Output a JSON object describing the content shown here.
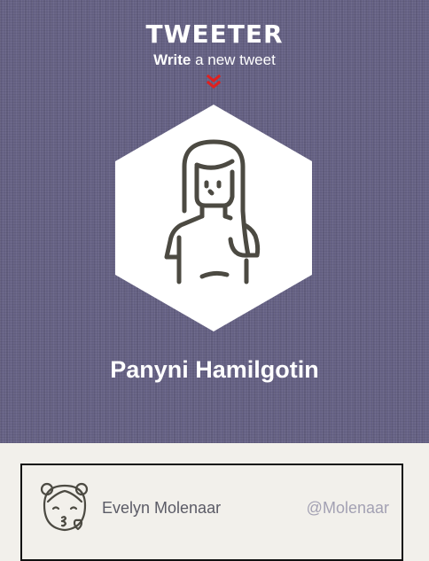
{
  "app": {
    "brand": "TWEETER",
    "tagline_strong": "Write",
    "tagline_rest": " a new tweet"
  },
  "hero": {
    "avatar_icon": "woman-avatar-icon",
    "scroll_icon": "double-chevron-down-icon",
    "user_name": "Panyni Hamilgotin"
  },
  "tweet": {
    "avatar_icon": "kiss-girl-avatar-icon",
    "display_name": "Evelyn Molenaar",
    "handle": "@Molenaar"
  },
  "colors": {
    "hero_bg": "#676386",
    "page_bg": "#f2f0eb",
    "accent_red": "#e0201f",
    "icon_stroke": "#4c4a42"
  }
}
